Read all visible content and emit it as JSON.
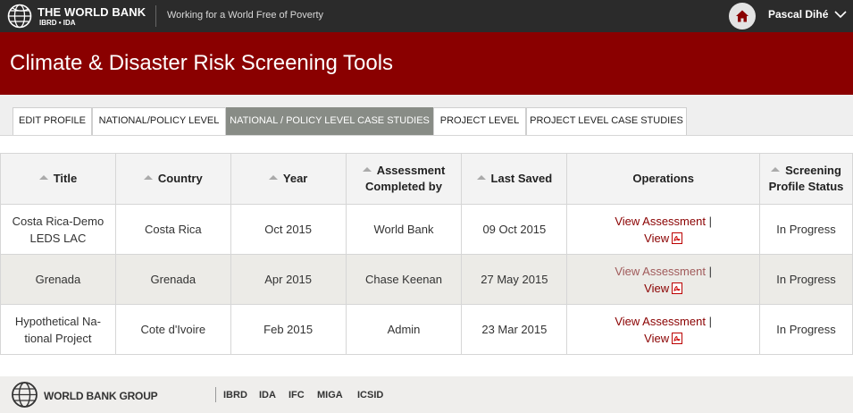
{
  "header": {
    "brand_name": "THE WORLD BANK",
    "brand_sub": "IBRD • IDA",
    "tagline": "Working for a World Free of Poverty",
    "user_name": "Pascal Dihé"
  },
  "page": {
    "title": "Climate & Disaster Risk Screening Tools"
  },
  "tabs": [
    {
      "label": "EDIT PROFILE",
      "active": false
    },
    {
      "label": "NATIONAL/POLICY LEVEL",
      "active": false
    },
    {
      "label": "NATIONAL / POLICY LEVEL CASE STUDIES",
      "active": true
    },
    {
      "label": "PROJECT LEVEL",
      "active": false
    },
    {
      "label": "PROJECT LEVEL CASE STUDIES",
      "active": false
    }
  ],
  "table": {
    "columns": [
      {
        "line1": "Title",
        "line2": "",
        "sortable": true
      },
      {
        "line1": "Country",
        "line2": "",
        "sortable": true
      },
      {
        "line1": "Year",
        "line2": "",
        "sortable": true
      },
      {
        "line1": "Assessment",
        "line2": "Completed by",
        "sortable": true
      },
      {
        "line1": "Last Saved",
        "line2": "",
        "sortable": true
      },
      {
        "line1": "Operations",
        "line2": "",
        "sortable": false
      },
      {
        "line1": "Screening",
        "line2": "Profile Status",
        "sortable": true
      }
    ],
    "rows": [
      {
        "title_l1": "Costa Rica-Demo",
        "title_l2": "LEDS LAC",
        "country": "Costa Rica",
        "year": "Oct 2015",
        "completed_by": "World Bank",
        "last_saved": "09 Oct 2015",
        "op_view_assessment": "View Assessment",
        "op_sep": "|",
        "op_view": "View",
        "status": "In Progress"
      },
      {
        "title_l1": "Grenada",
        "title_l2": "",
        "country": "Grenada",
        "year": "Apr 2015",
        "completed_by": "Chase Keenan",
        "last_saved": "27 May 2015",
        "op_view_assessment": "View Assessment",
        "op_sep": "|",
        "op_view": "View",
        "status": "In Progress"
      },
      {
        "title_l1": "Hypothetical Na-",
        "title_l2": "tional Project",
        "country": "Cote d'Ivoire",
        "year": "Feb 2015",
        "completed_by": "Admin",
        "last_saved": "23 Mar 2015",
        "op_view_assessment": "View Assessment",
        "op_sep": "|",
        "op_view": "View",
        "status": "In Progress"
      }
    ]
  },
  "footer": {
    "brand": "WORLD BANK GROUP",
    "links": [
      "IBRD",
      "IDA",
      "IFC",
      "MIGA",
      "ICSID"
    ]
  },
  "colors": {
    "brand_red": "#8a0000",
    "topbar": "#2b2b2b",
    "active_tab": "#888c86"
  },
  "icons": [
    "globe-logo-icon",
    "home-icon",
    "chevron-down-icon",
    "sort-caret-icon",
    "pdf-icon"
  ]
}
